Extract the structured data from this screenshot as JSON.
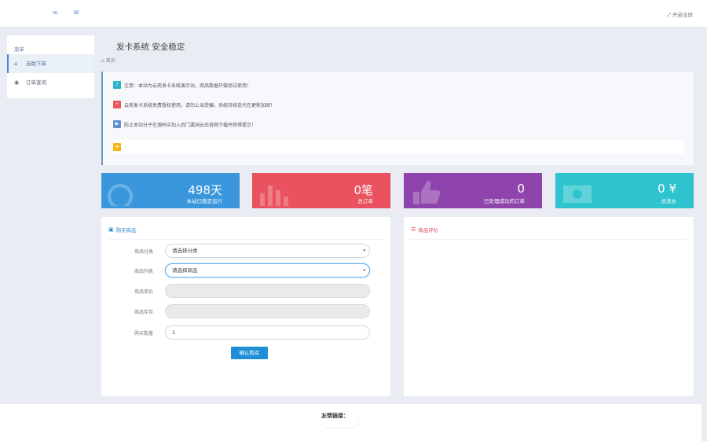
{
  "topbar": {
    "link_icon": "link-icon",
    "menu_icon": "list-icon",
    "fullscreen_label": "开启全屏"
  },
  "sidebar": {
    "heading": "菜单",
    "items": [
      {
        "label": "自助下单",
        "icon": "home-icon",
        "active": true
      },
      {
        "label": "订单查询",
        "icon": "eye-icon",
        "active": false
      }
    ]
  },
  "main": {
    "title": "发卡系统 安全稳定",
    "breadcrumb": "首页"
  },
  "notices": [
    {
      "text": "注意：本站为云商发卡系统演示站，商品数据只做测试使用！",
      "color": "#27b4c8",
      "icon": "bell-icon"
    },
    {
      "text": "云商发卡系统免费授权使用，请勿上当受骗，系统持续迭代在更新加固！",
      "color": "#e85661",
      "icon": "bolt-icon"
    },
    {
      "text": "防止本站分子在源码中加入后门漏洞云尚官网下载并获得提示！",
      "color": "#5d8fcf",
      "icon": "megaphone-icon"
    }
  ],
  "notice_add_icon": "plus-icon",
  "stats": [
    {
      "value": "498天",
      "label": "本站已稳定运行",
      "color": "#3a97dd"
    },
    {
      "value": "0笔",
      "label": "总订单",
      "color": "#e9525e"
    },
    {
      "value": "0",
      "label": "已处理成功的订单",
      "color": "#8f44ad"
    },
    {
      "value": "0 ¥",
      "label": "总流水",
      "color": "#2ec4cf"
    }
  ],
  "buy_panel": {
    "title": "购买商品",
    "title_color": "#2a8ad6",
    "icon": "bag-icon",
    "fields": [
      {
        "label": "商品分类",
        "value": "请选择分类",
        "type": "select"
      },
      {
        "label": "商品列表",
        "value": "请选择商品",
        "type": "select"
      },
      {
        "label": "商品单价",
        "value": "",
        "type": "disabled"
      },
      {
        "label": "商品库存",
        "value": "",
        "type": "disabled"
      },
      {
        "label": "购买数量",
        "value": "1",
        "type": "input"
      }
    ],
    "submit_label": "确认购买"
  },
  "review_panel": {
    "title": "商品评价",
    "title_color": "#e04a57",
    "icon": "menu-icon"
  },
  "footer": {
    "friends_label": "友情链接："
  }
}
